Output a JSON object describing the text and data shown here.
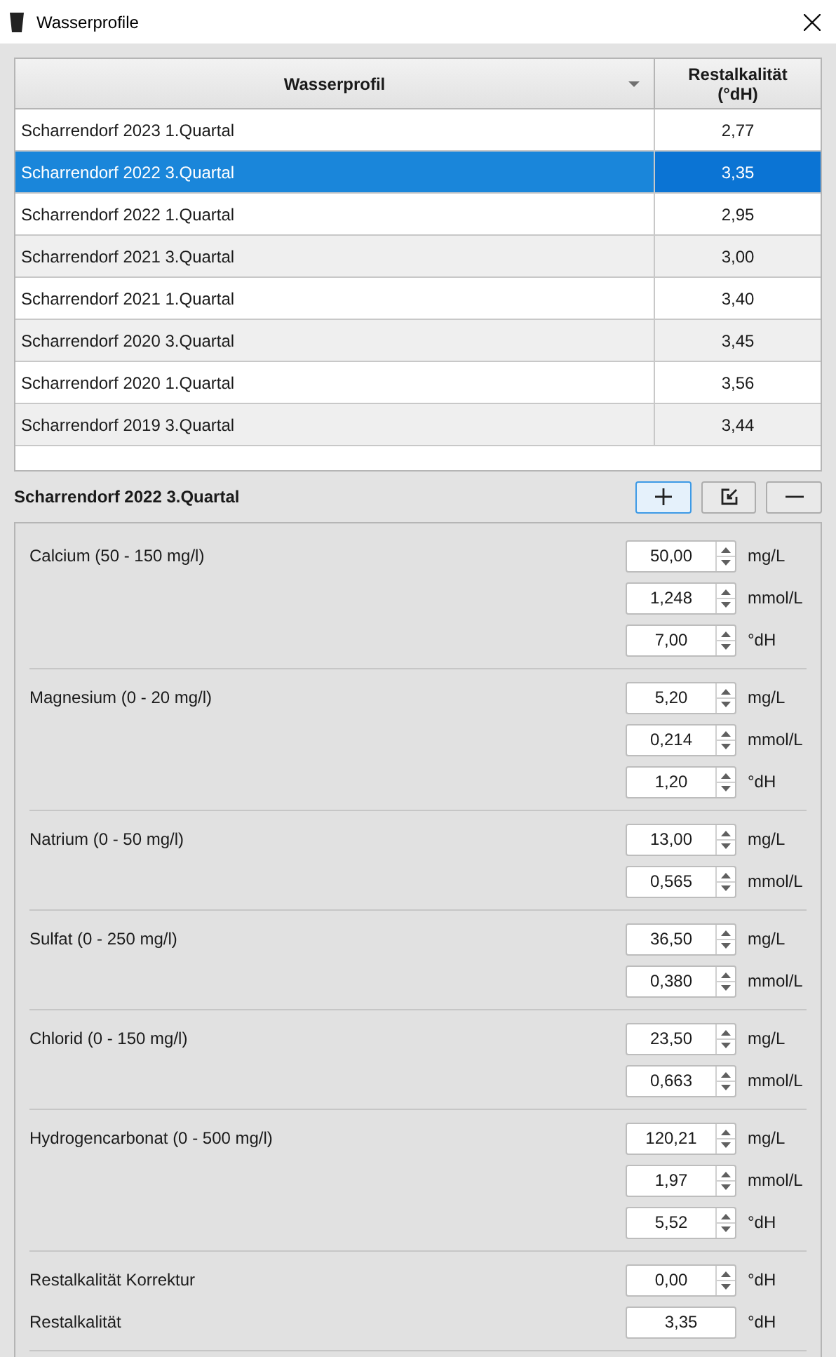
{
  "window": {
    "title": "Wasserprofile"
  },
  "table": {
    "columns": [
      {
        "label": "Wasserprofil",
        "sorted": true
      },
      {
        "label": "Restalkalität (°dH)",
        "sorted": false
      }
    ],
    "rows": [
      {
        "name": "Scharrendorf 2023 1.Quartal",
        "value": "2,77",
        "selected": false
      },
      {
        "name": "Scharrendorf 2022 3.Quartal",
        "value": "3,35",
        "selected": true
      },
      {
        "name": "Scharrendorf 2022 1.Quartal",
        "value": "2,95",
        "selected": false
      },
      {
        "name": "Scharrendorf 2021 3.Quartal",
        "value": "3,00",
        "selected": false
      },
      {
        "name": "Scharrendorf 2021 1.Quartal",
        "value": "3,40",
        "selected": false
      },
      {
        "name": "Scharrendorf 2020 3.Quartal",
        "value": "3,45",
        "selected": false
      },
      {
        "name": "Scharrendorf 2020 1.Quartal",
        "value": "3,56",
        "selected": false
      },
      {
        "name": "Scharrendorf 2019 3.Quartal",
        "value": "3,44",
        "selected": false
      }
    ]
  },
  "detail": {
    "title": "Scharrendorf 2022 3.Quartal",
    "groups": [
      {
        "rows": [
          {
            "label": "Calcium (50 - 150 mg/l)",
            "value": "50,00",
            "unit": "mg/L",
            "kind": "spin"
          },
          {
            "value": "1,248",
            "unit": "mmol/L",
            "kind": "spin"
          },
          {
            "value": "7,00",
            "unit": "°dH",
            "kind": "spin"
          }
        ]
      },
      {
        "rows": [
          {
            "label": "Magnesium (0 - 20 mg/l)",
            "value": "5,20",
            "unit": "mg/L",
            "kind": "spin"
          },
          {
            "value": "0,214",
            "unit": "mmol/L",
            "kind": "spin"
          },
          {
            "value": "1,20",
            "unit": "°dH",
            "kind": "spin"
          }
        ]
      },
      {
        "rows": [
          {
            "label": "Natrium (0 - 50 mg/l)",
            "value": "13,00",
            "unit": "mg/L",
            "kind": "spin"
          },
          {
            "value": "0,565",
            "unit": "mmol/L",
            "kind": "spin"
          }
        ]
      },
      {
        "rows": [
          {
            "label": "Sulfat (0 - 250 mg/l)",
            "value": "36,50",
            "unit": "mg/L",
            "kind": "spin"
          },
          {
            "value": "0,380",
            "unit": "mmol/L",
            "kind": "spin"
          }
        ]
      },
      {
        "rows": [
          {
            "label": "Chlorid (0 - 150 mg/l)",
            "value": "23,50",
            "unit": "mg/L",
            "kind": "spin"
          },
          {
            "value": "0,663",
            "unit": "mmol/L",
            "kind": "spin"
          }
        ]
      },
      {
        "rows": [
          {
            "label": "Hydrogencarbonat (0 - 500 mg/l)",
            "value": "120,21",
            "unit": "mg/L",
            "kind": "spin"
          },
          {
            "value": "1,97",
            "unit": "mmol/L",
            "kind": "spin"
          },
          {
            "value": "5,52",
            "unit": "°dH",
            "kind": "spin"
          }
        ]
      },
      {
        "rows": [
          {
            "label": "Restalkalität Korrektur",
            "value": "0,00",
            "unit": "°dH",
            "kind": "spin"
          },
          {
            "label": "Restalkalität",
            "value": "3,35",
            "unit": "°dH",
            "kind": "plain"
          }
        ]
      }
    ]
  }
}
